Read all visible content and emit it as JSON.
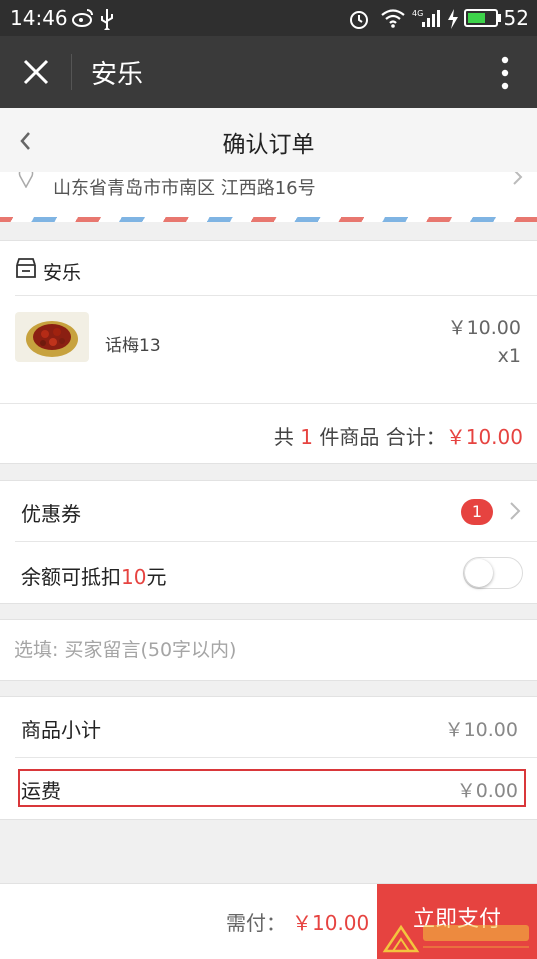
{
  "status_bar": {
    "time": "14:46",
    "battery_percent": "52",
    "network": "4G"
  },
  "app_bar": {
    "title": "安乐"
  },
  "page_header": {
    "title": "确认订单"
  },
  "address": {
    "text": "山东省青岛市市南区 江西路16号"
  },
  "shop": {
    "name": "安乐",
    "item": {
      "name": "话梅13",
      "price": "￥10.00",
      "qty": "x1"
    },
    "summary": {
      "prefix": "共",
      "count": "1",
      "suffix": "件商品 合计：",
      "total": "￥10.00"
    }
  },
  "discounts": {
    "coupon_label": "优惠券",
    "coupon_count": "1",
    "balance_prefix": "余额可抵扣",
    "balance_amount": "10",
    "balance_suffix": "元",
    "balance_toggle_on": false
  },
  "note": {
    "placeholder": "选填: 买家留言(50字以内)"
  },
  "costs": {
    "subtotal_label": "商品小计",
    "subtotal_value": "￥10.00",
    "shipping_label": "运费",
    "shipping_value": "￥0.00"
  },
  "footer": {
    "need_label": "需付：",
    "need_value": "￥10.00",
    "pay_button": "立即支付"
  },
  "colors": {
    "accent_red": "#e64340",
    "toolbar_dark": "#3a3a3a",
    "statusbar": "#2f2f2f"
  }
}
